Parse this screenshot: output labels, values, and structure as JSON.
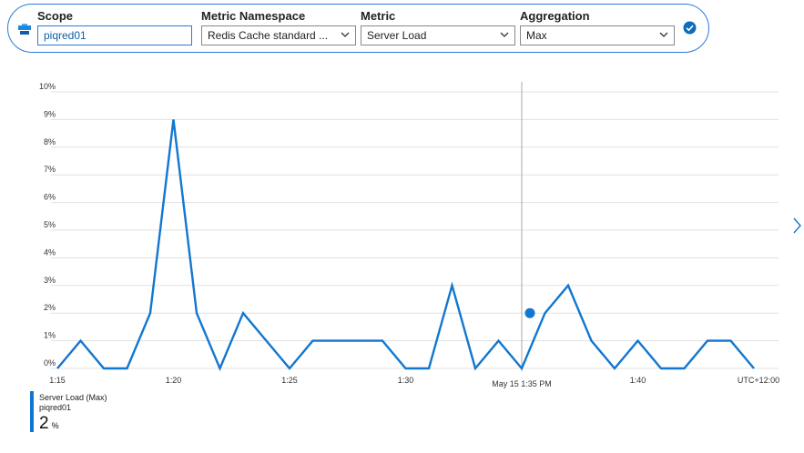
{
  "toolbar": {
    "scope_label": "Scope",
    "scope_value": "piqred01",
    "namespace_label": "Metric Namespace",
    "namespace_value": "Redis Cache standard ...",
    "metric_label": "Metric",
    "metric_value": "Server Load",
    "aggregation_label": "Aggregation",
    "aggregation_value": "Max",
    "scope_icon": "resource-icon",
    "confirm_icon": "checkmark-circle-icon"
  },
  "legend": {
    "series_name": "Server Load (Max)",
    "resource": "piqred01",
    "value": "2",
    "unit": "%"
  },
  "hover": {
    "time_label": "May 15 1:35 PM"
  },
  "timezone_label": "UTC+12:00",
  "colors": {
    "accent": "#1177d0",
    "border_accent": "#2b7bd6",
    "grid": "#e1e1e1",
    "crosshair": "#a9a9a9"
  },
  "chart_data": {
    "type": "line",
    "ylim": [
      0,
      10
    ],
    "yticks": [
      "0%",
      "1%",
      "2%",
      "3%",
      "4%",
      "5%",
      "6%",
      "7%",
      "8%",
      "9%",
      "10%"
    ],
    "xtick_labels": [
      "1:15",
      "1:20",
      "1:25",
      "1:30",
      "1:40"
    ],
    "xtick_minutes": [
      75,
      80,
      85,
      90,
      100
    ],
    "x_minutes": [
      75,
      75.5,
      76,
      76.5,
      77,
      77.5,
      78,
      78.5,
      79,
      79.5,
      80,
      80.5,
      81,
      81.5,
      82,
      82.5,
      83,
      83.5,
      84,
      84.5,
      85,
      85.5,
      86,
      86.5,
      87,
      87.5,
      88,
      88.5,
      89,
      89.5,
      90,
      90.5,
      91,
      91.5,
      92,
      92.5,
      93,
      93.5,
      94,
      94.5,
      95,
      95.5,
      96,
      96.5,
      97,
      97.5,
      98,
      98.5,
      99,
      99.5,
      100,
      100.5,
      101,
      101.5,
      102,
      102.5,
      103,
      103.5,
      104,
      104.5,
      105
    ],
    "series": [
      {
        "name": "Server Load (Max)",
        "values": [
          0,
          1,
          0,
          0,
          2,
          9,
          2,
          0,
          2,
          1,
          0,
          1,
          1,
          1,
          1,
          0,
          0,
          3,
          0,
          1,
          0,
          2,
          3,
          1,
          0,
          1,
          0,
          0,
          1,
          1,
          0
        ]
      }
    ],
    "point_step_minutes": 1,
    "hover_minute": 95,
    "hover_value": 2
  }
}
